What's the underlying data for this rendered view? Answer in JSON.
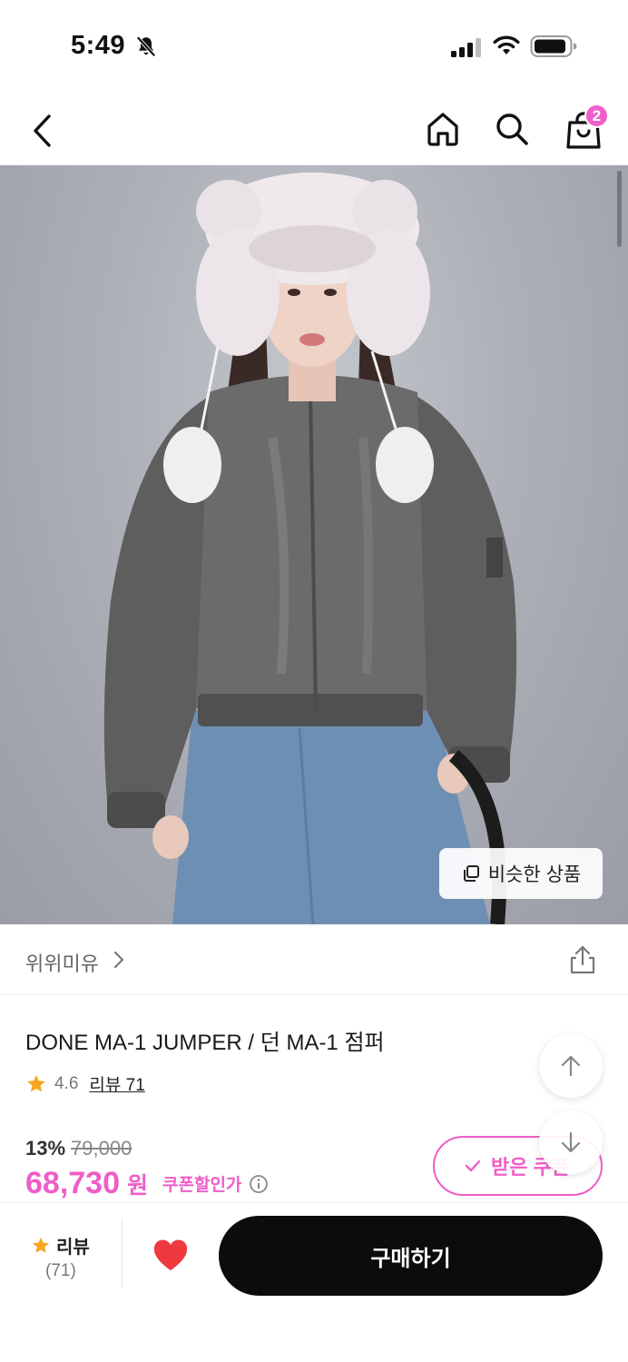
{
  "status_bar": {
    "time": "5:49",
    "icons": [
      "bell-slash-icon",
      "signal-icon",
      "wifi-icon",
      "battery-icon"
    ]
  },
  "nav": {
    "cart_count": "2",
    "icons": [
      "back-icon",
      "home-icon",
      "search-icon",
      "shopping-bag-icon"
    ]
  },
  "product_image": {
    "similar_label": "비슷한 상품"
  },
  "brand": {
    "name": "위위미유"
  },
  "product": {
    "title": "DONE MA-1 JUMPER / 던 MA-1 점퍼",
    "rating": "4.6",
    "review_label": "리뷰 71",
    "discount_rate": "13%",
    "original_price": "79,000",
    "sale_price": "68,730",
    "currency": "원",
    "coupon_label": "쿠폰할인가",
    "coupon_button_label": "받은 쿠폰"
  },
  "bottom_bar": {
    "review_label": "리뷰",
    "review_count": "(71)",
    "buy_label": "구매하기"
  },
  "colors": {
    "accent_pink": "#ef5dc8",
    "star": "#f5a623",
    "heart": "#f0393f",
    "buy_button": "#0c0c0c"
  }
}
